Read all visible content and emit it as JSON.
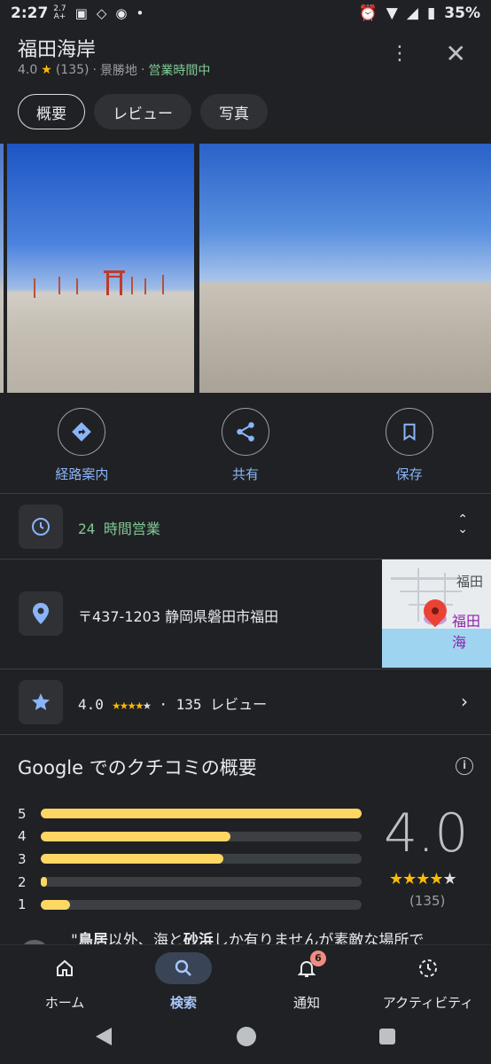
{
  "status_bar": {
    "time": "2:27",
    "net_speed_top": "2.7",
    "net_speed_bottom": "A+",
    "battery": "35%"
  },
  "header": {
    "title": "福田海岸",
    "rating": "4.0",
    "review_count": "(135)",
    "category": "景勝地",
    "open_status": "営業時間中"
  },
  "tabs": [
    {
      "label": "概要",
      "active": true
    },
    {
      "label": "レビュー",
      "active": false
    },
    {
      "label": "写真",
      "active": false
    }
  ],
  "actions": [
    {
      "label": "経路案内",
      "icon": "directions-icon"
    },
    {
      "label": "共有",
      "icon": "share-icon"
    },
    {
      "label": "保存",
      "icon": "bookmark-icon"
    }
  ],
  "info": {
    "hours": "24 時間営業",
    "address": "〒437-1203 静岡県磐田市福田",
    "map_label_top": "福田",
    "map_label_pin": "福田海",
    "rating_row": {
      "rating": "4.0",
      "count_label": "135 レビュー"
    }
  },
  "review_summary": {
    "title": "Google でのクチコミの概要",
    "distribution": [
      {
        "stars": "5",
        "fraction": 1.0
      },
      {
        "stars": "4",
        "fraction": 0.59
      },
      {
        "stars": "3",
        "fraction": 0.57
      },
      {
        "stars": "2",
        "fraction": 0.02
      },
      {
        "stars": "1",
        "fraction": 0.09
      }
    ],
    "average": "4.0",
    "average_stars": 4,
    "count": "(135)",
    "snippet_open_quote": "\"",
    "snippet_bold1": "鳥居",
    "snippet_text1": "以外、海と",
    "snippet_bold2": "砂浜",
    "snippet_text2": "しか有りませんが素敵な場所で"
  },
  "bottom_nav": [
    {
      "label": "ホーム",
      "icon": "home-icon",
      "active": false
    },
    {
      "label": "検索",
      "icon": "search-icon",
      "active": true
    },
    {
      "label": "通知",
      "icon": "bell-icon",
      "active": false,
      "badge": "6"
    },
    {
      "label": "アクティビティ",
      "icon": "activity-icon",
      "active": false
    }
  ],
  "colors": {
    "accent": "#8ab4f8",
    "open_green": "#81c995",
    "star_yellow": "#fbbc04",
    "bar_yellow": "#fdd663"
  }
}
